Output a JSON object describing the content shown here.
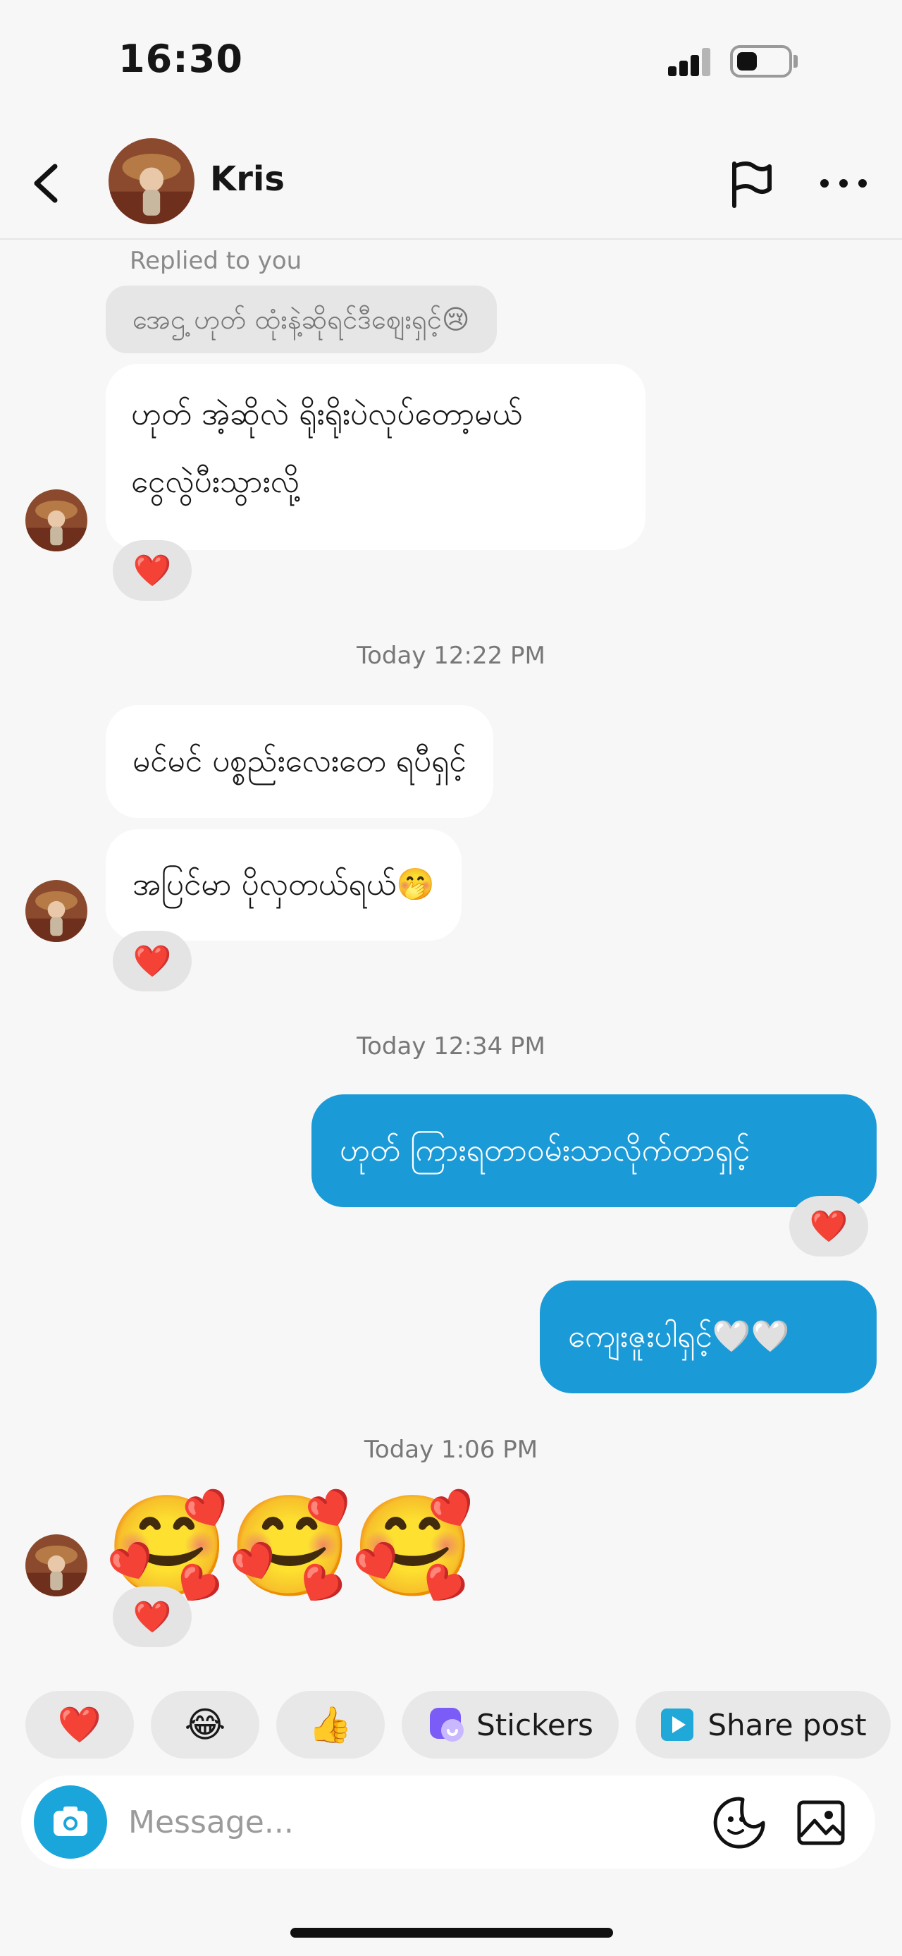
{
  "status_bar": {
    "time": "16:30"
  },
  "header": {
    "contact_name": "Kris"
  },
  "messages": {
    "replied_label": "Replied to you",
    "quoted_text": "အေဌ့ ဟုတ် ထုံးနဲ့ဆိုရင်ဒီဈေးရှင့်😢",
    "incoming_1_line1": "ဟုတ် အဲ့ဆိုလဲ ရိုးရိုးပဲလုပ်တော့မယ်",
    "incoming_1_line2": "ငွေလွဲပီးသွားလို့",
    "reaction_heart": "❤️",
    "timestamp_1": "Today 12:22 PM",
    "incoming_2": "မင်မင် ပစ္စည်းလေးတေ ရပီရှင့်",
    "incoming_3": "အပြင်မာ ပိုလှတယ်ရယ်🤭",
    "timestamp_2": "Today 12:34 PM",
    "outgoing_1": "ဟုတ် ကြားရတာဝမ်းသာလိုက်တာရှင့်",
    "outgoing_2": "ကျေးဇူးပါရှင့်🤍🤍",
    "timestamp_3": "Today 1:06 PM",
    "emoji_message": "🥰🥰🥰"
  },
  "quick_actions": {
    "heart": "❤️",
    "laugh": "😂",
    "thumbs": "👍",
    "stickers_label": "Stickers",
    "share_post_label": "Share post"
  },
  "composer": {
    "placeholder": "Message..."
  },
  "colors": {
    "outgoing_bubble": "#1b9ad8",
    "camera_button": "#1aa5db",
    "background": "#f7f7f7",
    "sticker_icon": "#7b5cf6",
    "share_icon": "#20a8d8"
  }
}
